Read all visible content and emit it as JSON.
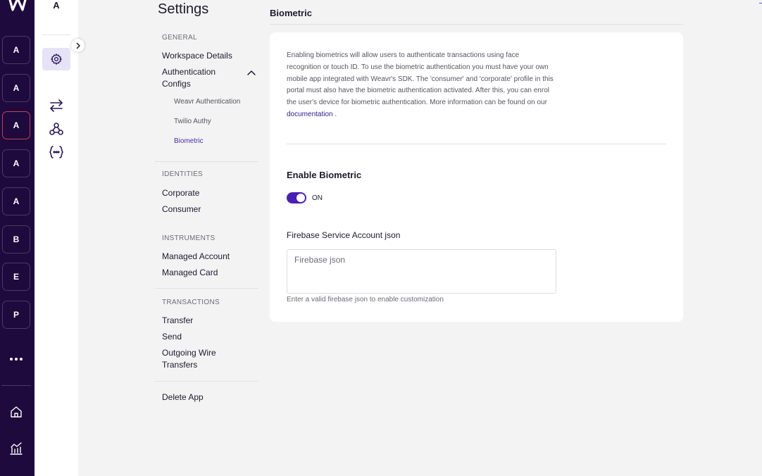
{
  "rail": {
    "apps": [
      {
        "letter": "A",
        "active": false
      },
      {
        "letter": "A",
        "active": false
      },
      {
        "letter": "A",
        "active": true
      },
      {
        "letter": "A",
        "active": false
      },
      {
        "letter": "A",
        "active": false
      },
      {
        "letter": "B",
        "active": false
      },
      {
        "letter": "E",
        "active": false
      },
      {
        "letter": "P",
        "active": false
      }
    ],
    "icons": [
      "more-icon",
      "home-icon",
      "analytics-icon"
    ]
  },
  "subrail": {
    "title": "A",
    "icons": [
      "gear-icon",
      "transfer-arrows-icon",
      "webhook-icon",
      "api-braces-icon"
    ]
  },
  "settings": {
    "title": "Settings",
    "general": {
      "section": "GENERAL",
      "workspace_details": "Workspace Details",
      "authentication_configs": "Authentication Configs",
      "sub": {
        "weavr_authentication": "Weavr Authentication",
        "twilio_authy": "Twilio Authy",
        "biometric": "Biometric"
      }
    },
    "identities": {
      "section": "IDENTITIES",
      "corporate": "Corporate",
      "consumer": "Consumer"
    },
    "instruments": {
      "section": "INSTRUMENTS",
      "managed_account": "Managed Account",
      "managed_card": "Managed Card"
    },
    "transactions": {
      "section": "TRANSACTIONS",
      "transfer": "Transfer",
      "send": "Send",
      "outgoing_wire_transfers": "Outgoing Wire Transfers"
    },
    "delete_app": "Delete App"
  },
  "main": {
    "title": "Biometric",
    "description": "Enabling biometrics will allow users to authenticate transactions using face recognition or touch ID. To use the biometric authentication you must have your own mobile app integrated with Weavr's SDK. The 'consumer' and 'corporate' profile in this portal must also have the biometric authentication activated. After this, you can enrol the user's device for biometric authentication. More information can be found on our",
    "doc_link": "documentation",
    "doc_suffix": " .",
    "enable_title": "Enable Biometric",
    "toggle_label": "ON",
    "field_label": "Firebase Service Account json",
    "field_value": "",
    "field_placeholder": "Firebase json",
    "field_hint": "Enter a valid firebase json to enable customization"
  },
  "colors": {
    "rail_bg": "#1e0a3c",
    "accent": "#4b1fb0",
    "active_link": "#4b2da3"
  }
}
